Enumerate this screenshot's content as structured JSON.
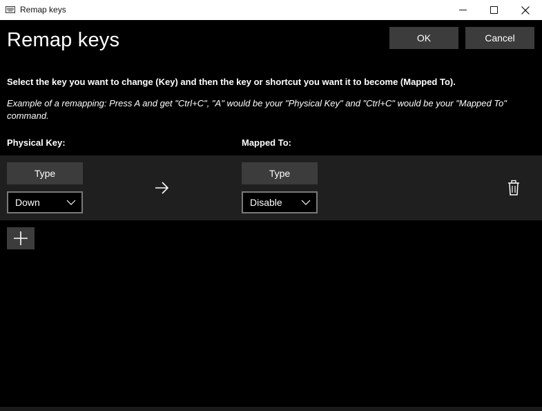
{
  "window": {
    "title": "Remap keys",
    "icon": "keyboard-icon",
    "controls": [
      "minimize-icon",
      "maximize-icon",
      "close-icon"
    ]
  },
  "header": {
    "heading": "Remap keys",
    "ok_label": "OK",
    "cancel_label": "Cancel"
  },
  "instructions": "Select the key you want to change (Key) and then the key or shortcut you want it to become (Mapped To).",
  "example": "Example of a remapping: Press A and get \"Ctrl+C\", \"A\" would be your \"Physical Key\" and \"Ctrl+C\" would be your \"Mapped To\" command.",
  "columns": {
    "physical_label": "Physical Key:",
    "mapped_label": "Mapped To:"
  },
  "remaps": [
    {
      "physical": {
        "type_label": "Type",
        "value": "Down"
      },
      "mapped": {
        "type_label": "Type",
        "value": "Disable"
      },
      "arrow_icon": "arrow-right-icon",
      "delete_icon": "trash-icon"
    }
  ],
  "add_button_icon": "plus-icon",
  "colors": {
    "background": "#000000",
    "row_background": "#1f1f1f",
    "button": "#3c3c3c",
    "combo_border": "#7a7a7a",
    "text": "#ffffff"
  }
}
